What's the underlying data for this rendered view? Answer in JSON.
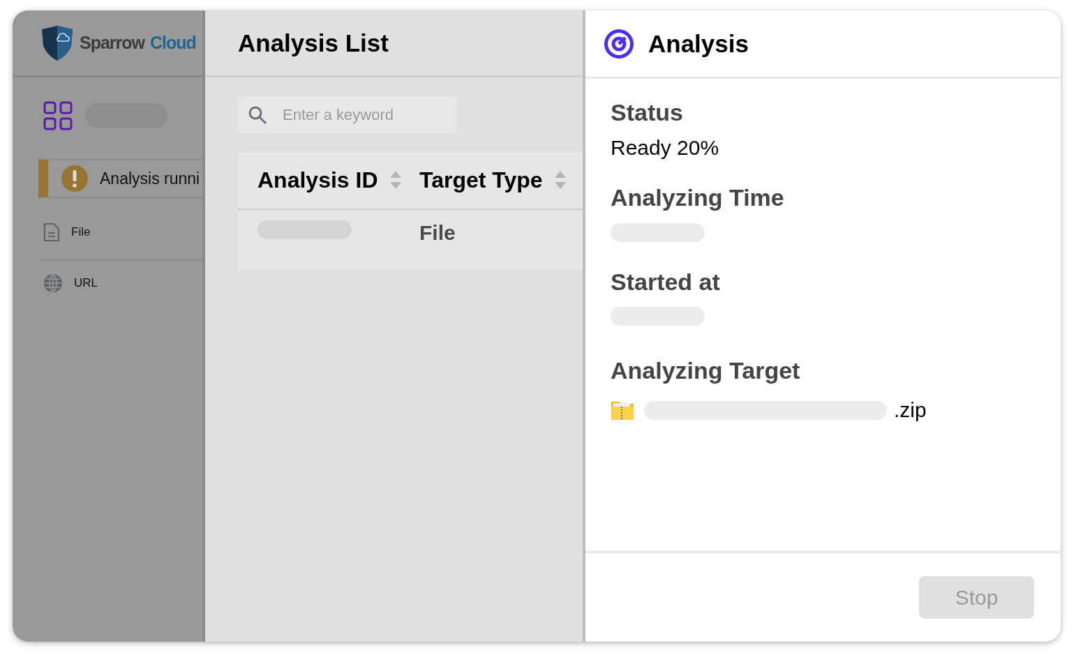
{
  "sidebar": {
    "logo": {
      "word_1": "Sparrow",
      "word_2": "Cloud"
    },
    "notice": {
      "text": "Analysis runni"
    },
    "items": [
      {
        "label": "File",
        "kind": "file"
      },
      {
        "label": "URL",
        "kind": "url"
      }
    ]
  },
  "list_panel": {
    "title": "Analysis List",
    "search": {
      "placeholder": "Enter a keyword"
    },
    "table": {
      "columns": [
        "Analysis ID",
        "Target Type"
      ],
      "rows": [
        {
          "target_type": "File"
        }
      ]
    }
  },
  "detail_panel": {
    "title": "Analysis",
    "fields": [
      {
        "label": "Status",
        "kind": "text",
        "value": "Ready 20%"
      },
      {
        "label": "Analyzing Time",
        "kind": "pending"
      },
      {
        "label": "Started at",
        "kind": "pending"
      },
      {
        "label": "Analyzing Target",
        "kind": "file",
        "value": ".zip"
      }
    ],
    "buttons": [
      {
        "label": "Stop",
        "disabled": true
      }
    ]
  }
}
